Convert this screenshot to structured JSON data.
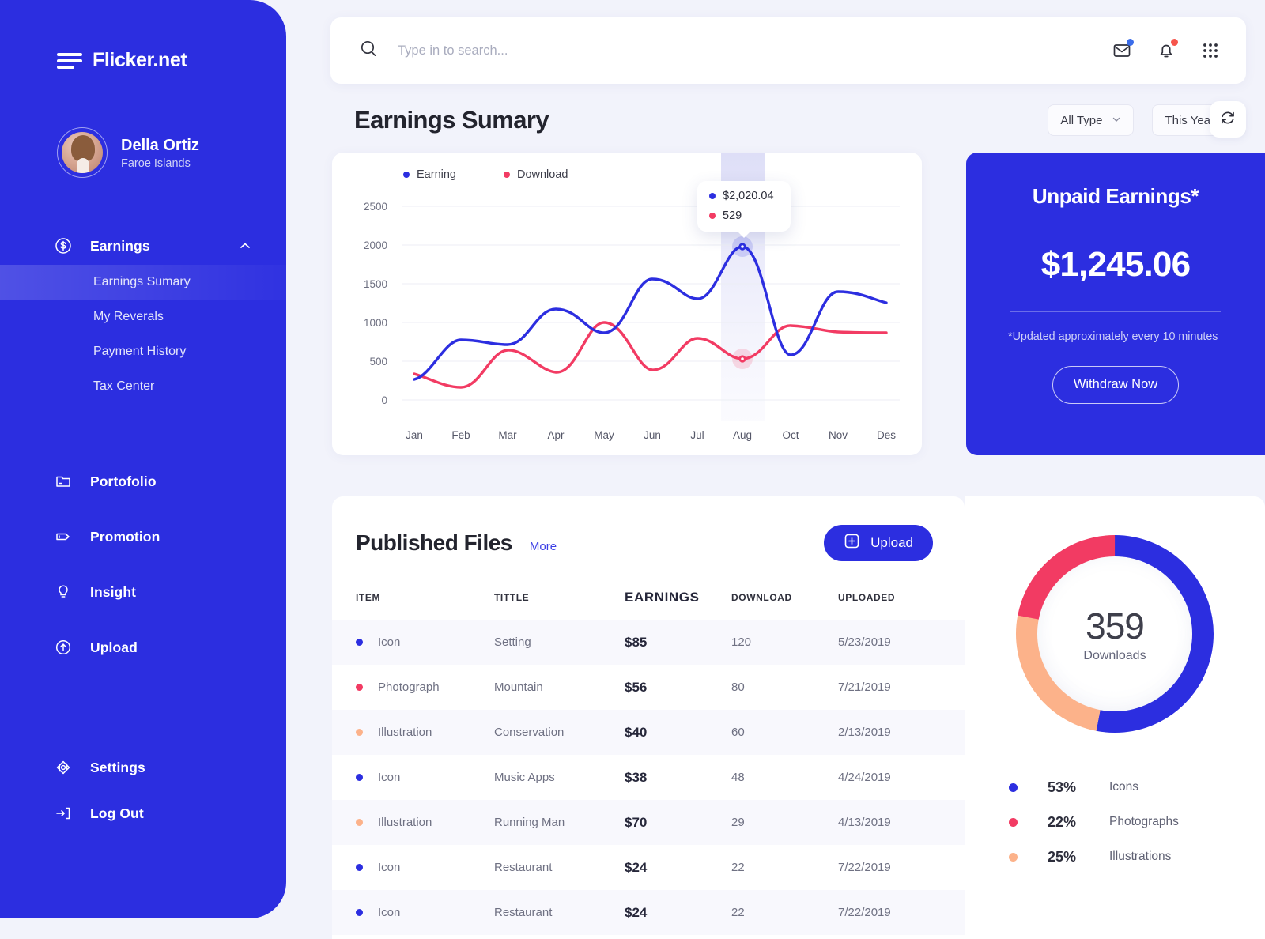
{
  "brand": {
    "name": "Flicker.net"
  },
  "profile": {
    "name": "Della Ortiz",
    "location": "Faroe Islands"
  },
  "sidebar": {
    "earnings": {
      "label": "Earnings",
      "icon": "dollar-circle-icon",
      "chevron": "chevron-up-icon"
    },
    "sub_items": [
      {
        "label": "Earnings Sumary",
        "active": true
      },
      {
        "label": "My Reverals",
        "active": false
      },
      {
        "label": "Payment History",
        "active": false
      },
      {
        "label": "Tax Center",
        "active": false
      }
    ],
    "items": [
      {
        "label": "Portofolio",
        "icon": "folder-icon"
      },
      {
        "label": "Promotion",
        "icon": "tag-icon"
      },
      {
        "label": "Insight",
        "icon": "lightbulb-icon"
      },
      {
        "label": "Upload",
        "icon": "upload-circle-icon"
      }
    ],
    "bottom_items": [
      {
        "label": "Settings",
        "icon": "settings-icon"
      },
      {
        "label": "Log Out",
        "icon": "logout-icon"
      }
    ]
  },
  "topbar": {
    "search_placeholder": "Type in to search...",
    "search_value": "",
    "icons": [
      "search-icon",
      "mail-icon",
      "bell-icon",
      "grid-apps-icon"
    ],
    "mail_badge_color": "#3b6dea",
    "bell_badge_color": "#f6554c"
  },
  "section": {
    "title": "Earnings Sumary",
    "type_filter": "All Type",
    "period_filter": "This Year",
    "refresh_icon": "refresh-icon"
  },
  "unpaid": {
    "title": "Unpaid Earnings*",
    "amount": "$1,245.06",
    "note": "*Updated approximately every 10 minutes",
    "button": "Withdraw Now"
  },
  "files": {
    "title": "Published Files",
    "more_label": "More",
    "upload_label": "Upload",
    "columns": [
      "ITEM",
      "TITTLE",
      "EARNINGS",
      "DOWNLOAD",
      "UPLOADED"
    ],
    "rows": [
      {
        "item": "Icon",
        "color": "#2c2ee0",
        "title": "Setting",
        "earnings": "$85",
        "download": "120",
        "uploaded": "5/23/2019"
      },
      {
        "item": "Photograph",
        "color": "#f23b63",
        "title": "Mountain",
        "earnings": "$56",
        "download": "80",
        "uploaded": "7/21/2019"
      },
      {
        "item": "Illustration",
        "color": "#fcb28a",
        "title": "Conservation",
        "earnings": "$40",
        "download": "60",
        "uploaded": "2/13/2019"
      },
      {
        "item": "Icon",
        "color": "#2c2ee0",
        "title": "Music Apps",
        "earnings": "$38",
        "download": "48",
        "uploaded": "4/24/2019"
      },
      {
        "item": "Illustration",
        "color": "#fcb28a",
        "title": "Running Man",
        "earnings": "$70",
        "download": "29",
        "uploaded": "4/13/2019"
      },
      {
        "item": "Icon",
        "color": "#2c2ee0",
        "title": "Restaurant",
        "earnings": "$24",
        "download": "22",
        "uploaded": "7/22/2019"
      },
      {
        "item": "Icon",
        "color": "#2c2ee0",
        "title": "Restaurant",
        "earnings": "$24",
        "download": "22",
        "uploaded": "7/22/2019"
      }
    ]
  },
  "chart_data": [
    {
      "type": "line",
      "title": "Earnings Sumary",
      "xlabel": "",
      "ylabel": "",
      "x": [
        "Jan",
        "Feb",
        "Mar",
        "Apr",
        "May",
        "Jun",
        "Jul",
        "Aug",
        "Oct",
        "Nov",
        "Des"
      ],
      "ylim": [
        0,
        2500
      ],
      "yticks": [
        0,
        500,
        1000,
        1500,
        2000,
        2500
      ],
      "grid": true,
      "legend_position": "top-left",
      "series": [
        {
          "name": "Earning",
          "color": "#2c2ee0",
          "values": [
            270,
            780,
            715,
            1175,
            870,
            1560,
            1310,
            2000,
            730,
            1680,
            1570
          ]
        },
        {
          "name": "Download",
          "color": "#f23b63",
          "values": [
            340,
            165,
            640,
            420,
            1000,
            395,
            800,
            529,
            990,
            880,
            860
          ]
        }
      ],
      "highlight": {
        "category": "Aug",
        "tooltip": [
          {
            "color": "#2c2ee0",
            "text": "$2,020.04"
          },
          {
            "color": "#f23b63",
            "text": "529"
          }
        ]
      }
    },
    {
      "type": "pie",
      "title": "Downloads",
      "center_value": "359",
      "center_label": "Downloads",
      "labels": [
        "Icons",
        "Photographs",
        "Illustrations"
      ],
      "values": [
        53,
        22,
        25
      ],
      "colors": [
        "#2c2ee0",
        "#f23b63",
        "#fcb28a"
      ],
      "legend": [
        {
          "pct": "53%",
          "name": "Icons",
          "color": "#2c2ee0"
        },
        {
          "pct": "22%",
          "name": "Photographs",
          "color": "#f23b63"
        },
        {
          "pct": "25%",
          "name": "Illustrations",
          "color": "#fcb28a"
        }
      ]
    }
  ]
}
